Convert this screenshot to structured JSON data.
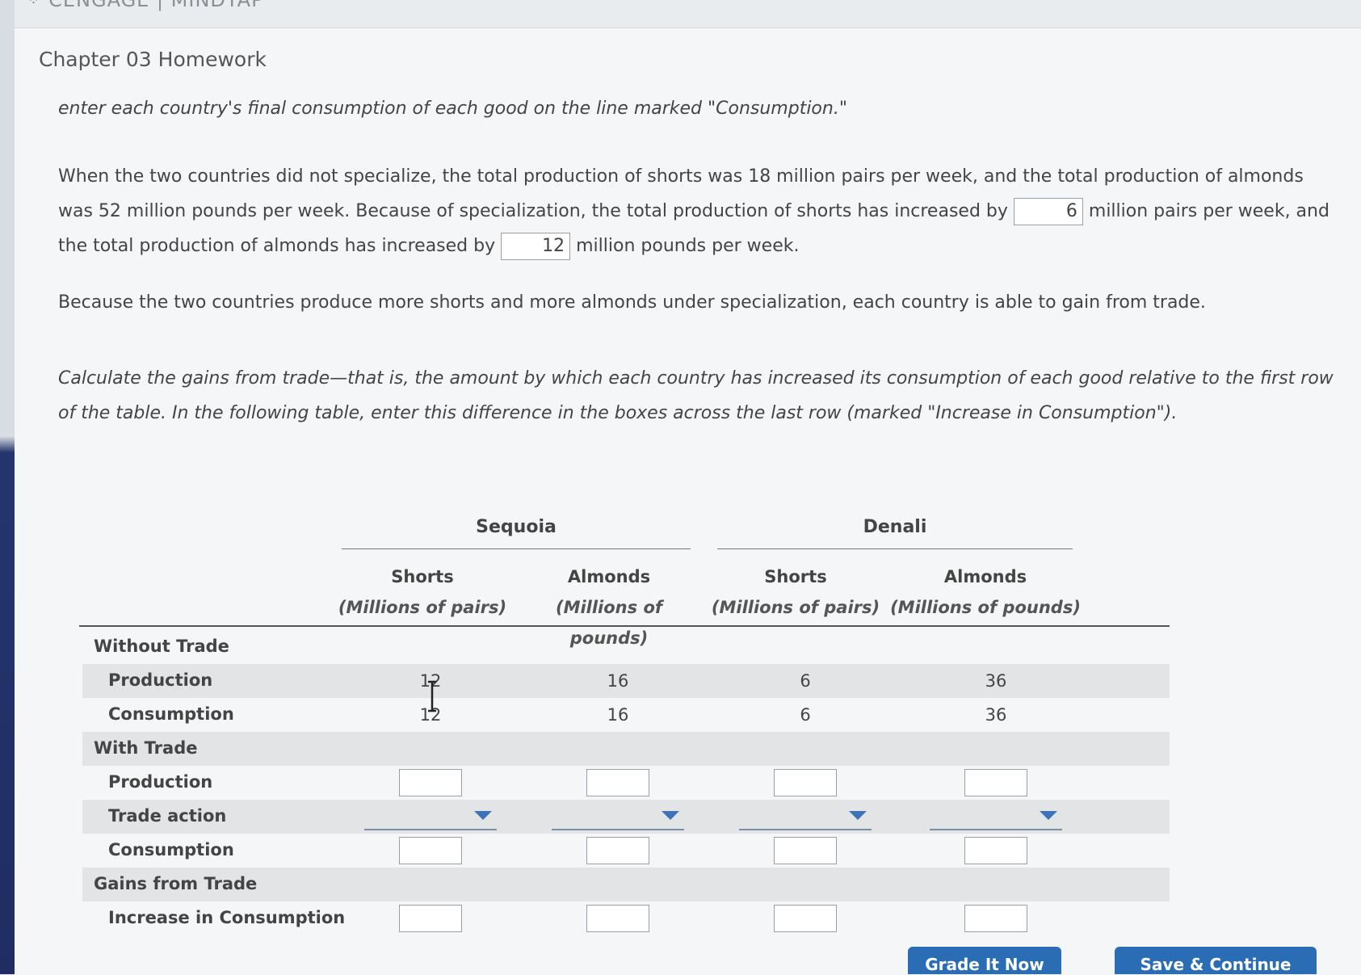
{
  "brand": {
    "logo_text": "CENGAGE | MINDTAP"
  },
  "header": {
    "chapter_title": "Chapter 03 Homework"
  },
  "instructions": {
    "consumption_note": "enter each country's final consumption of each good on the line marked \"Consumption.\"",
    "spec_text_a": "When the two countries did not specialize, the total production of shorts was 18 million pairs per week, and the total production of almonds was 52 million pounds per week. Because of specialization, the total production of shorts has increased by",
    "shorts_increase_value": "6",
    "spec_text_b": "million pairs per week, and the total production of almonds has increased by",
    "almonds_increase_value": "12",
    "spec_text_c": "million pounds per week.",
    "gain_statement": "Because the two countries produce more shorts and more almonds under specialization, each country is able to gain from trade.",
    "calc_instruction": "Calculate the gains from trade—that is, the amount by which each country has increased its consumption of each good relative to the first row of the table. In the following table, enter this difference in the boxes across the last row (marked \"Increase in Consumption\")."
  },
  "table": {
    "countries": [
      "Sequoia",
      "Denali"
    ],
    "columns": [
      {
        "good": "Shorts",
        "unit": "(Millions of pairs)"
      },
      {
        "good": "Almonds",
        "unit": "(Millions of pounds)"
      },
      {
        "good": "Shorts",
        "unit": "(Millions of pairs)"
      },
      {
        "good": "Almonds",
        "unit": "(Millions of pounds)"
      }
    ],
    "sections": {
      "without_trade": "Without Trade",
      "with_trade": "With Trade",
      "gains": "Gains from Trade"
    },
    "rows": {
      "production": {
        "label": "Production",
        "values": [
          "12",
          "16",
          "6",
          "36"
        ]
      },
      "consumption": {
        "label": "Consumption",
        "values": [
          "12",
          "16",
          "6",
          "36"
        ]
      },
      "wt_production": {
        "label": "Production"
      },
      "trade_action": {
        "label": "Trade action"
      },
      "wt_consumption": {
        "label": "Consumption"
      },
      "increase": {
        "label": "Increase in Consumption"
      }
    }
  },
  "buttons": {
    "grade": "Grade It Now",
    "save": "Save & Continue"
  }
}
